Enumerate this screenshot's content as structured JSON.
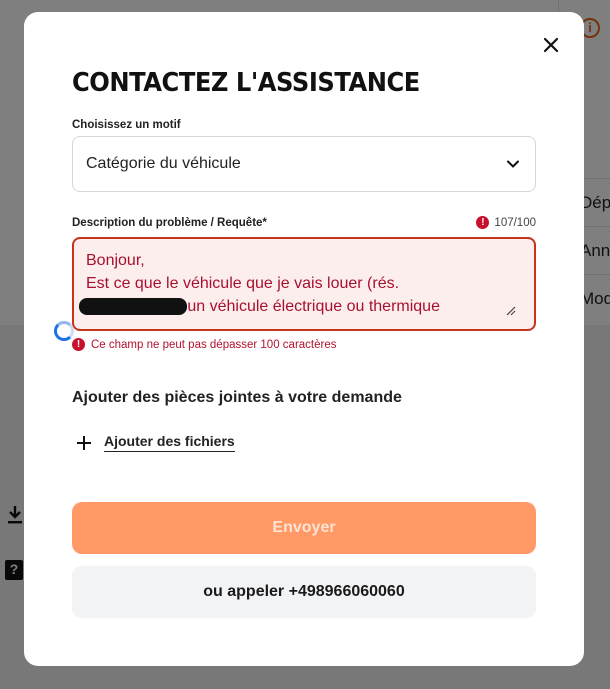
{
  "background": {
    "right_items": [
      "Dépô",
      "Annu",
      "Modi"
    ]
  },
  "modal": {
    "title": "CONTACTEZ L'ASSISTANCE",
    "motif_label": "Choisissez un motif",
    "motif_value": "Catégorie du véhicule",
    "description_label": "Description du problème / Requête*",
    "counter": "107/100",
    "description_value": "Bonjour,\nEst ce que le véhicule que je vais louer (rés.\n               , est un véhicule électrique ou thermique",
    "error_message": "Ce champ ne peut pas dépasser 100 caractères",
    "attachments_title": "Ajouter des pièces jointes à votre demande",
    "add_files_label": "Ajouter des fichiers",
    "send_label": "Envoyer",
    "call_label": "ou appeler +498966060060"
  },
  "colors": {
    "accent_disabled": "#ff9966",
    "error": "#c8102e",
    "info_orange": "#e8661f"
  },
  "icons": {
    "close": "close-icon",
    "chevron": "chevron-down-icon",
    "error": "error-icon",
    "plus": "plus-icon",
    "download": "download-icon",
    "help": "help-icon",
    "info": "info-icon"
  }
}
